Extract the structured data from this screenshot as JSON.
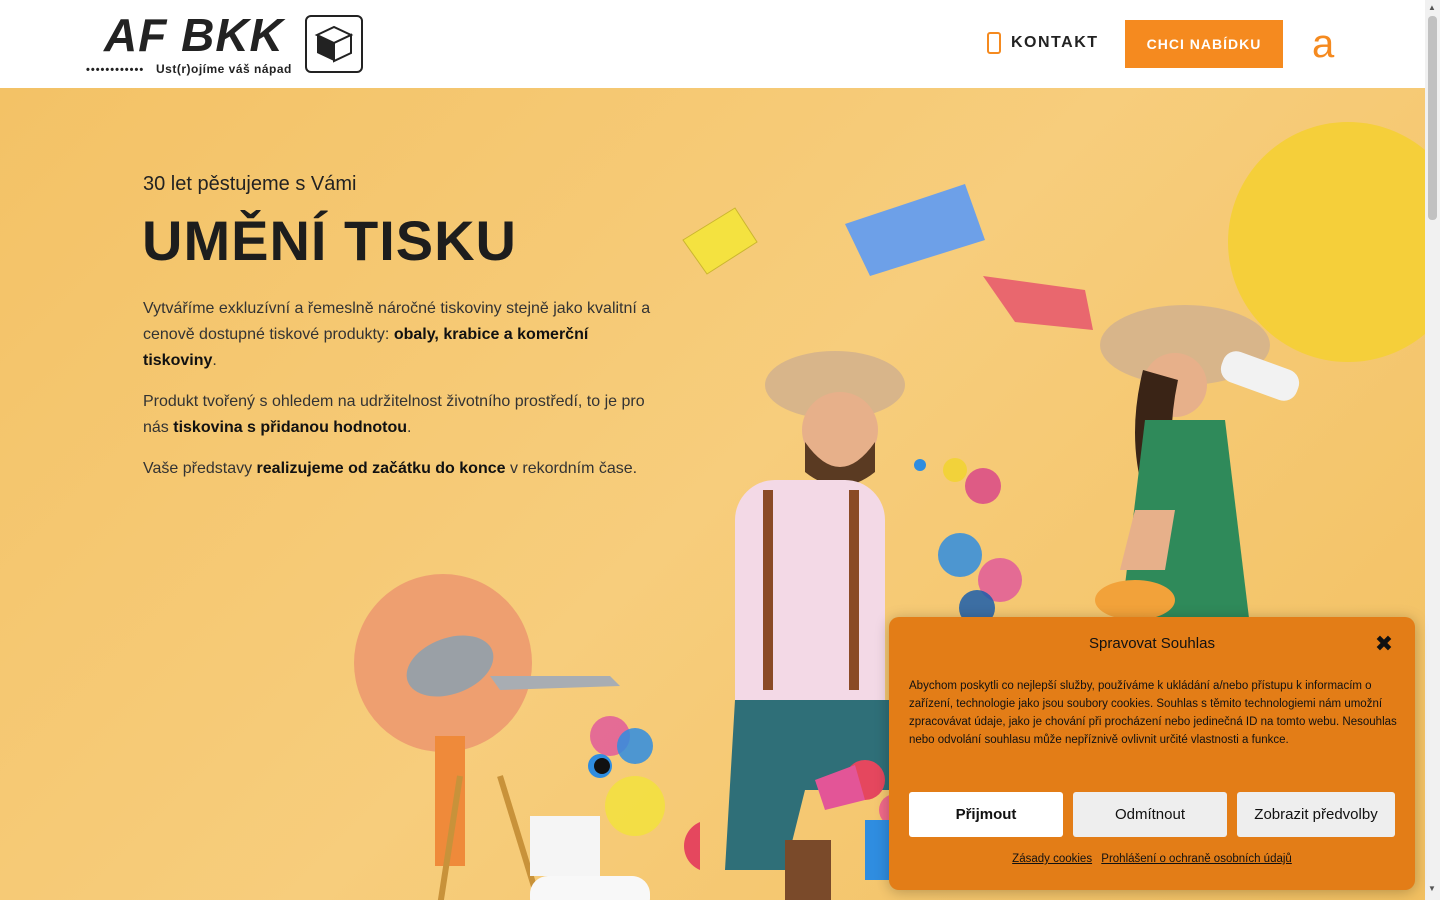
{
  "header": {
    "logo_text": "AF BKK",
    "logo_dots": "••••••••••••",
    "logo_tagline": "Ust(r)ojíme váš nápad",
    "contact_label": "KONTAKT",
    "cta_label": "CHCI NABÍDKU",
    "a_icon_glyph": "a"
  },
  "hero": {
    "subtitle": "30 let pěstujeme s Vámi",
    "title": "UMĚNÍ TISKU",
    "p1_a": "Vytváříme exkluzívní a řemeslně náročné tiskoviny stejně jako kvalitní a cenově dostupné tiskové produkty: ",
    "p1_b": "obaly, krabice a komerční tiskoviny",
    "p1_c": ".",
    "p2_a": "Produkt tvořený s ohledem na udržitelnost životního prostředí, to je pro nás ",
    "p2_b": "tiskovina s přidanou hodnotou",
    "p2_c": ".",
    "p3_a": "Vaše představy ",
    "p3_b": "realizujeme od začátku do konce",
    "p3_c": " v rekordním čase."
  },
  "consent": {
    "title": "Spravovat Souhlas",
    "close_glyph": "✖",
    "text": "Abychom poskytli co nejlepší služby, používáme k ukládání a/nebo přístupu k informacím o zařízení, technologie jako jsou soubory cookies. Souhlas s těmito technologiemi nám umožní zpracovávat údaje, jako je chování při procházení nebo jedinečná ID na tomto webu. Nesouhlas nebo odvolání souhlasu může nepříznivě ovlivnit určité vlastnosti a funkce.",
    "accept_label": "Přijmout",
    "deny_label": "Odmítnout",
    "prefs_label": "Zobrazit předvolby",
    "link_cookies": "Zásady cookies",
    "link_privacy": "Prohlášení o ochraně osobních údajů"
  },
  "colors": {
    "accent": "#f58a1f",
    "hero_bg": "#f3c266",
    "consent_bg": "#e37d17"
  }
}
